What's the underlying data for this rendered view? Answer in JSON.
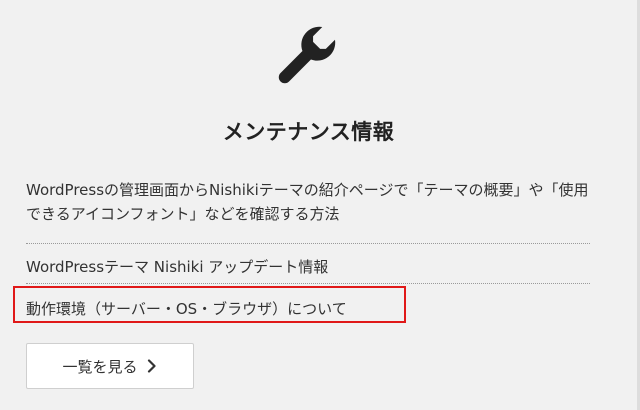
{
  "section": {
    "icon": "wrench-icon",
    "title": "メンテナンス情報"
  },
  "posts": [
    {
      "title": "WordPressの管理画面からNishikiテーマの紹介ページで「テーマの概要」や「使用できるアイコンフォント」などを確認する方法"
    },
    {
      "title": "WordPressテーマ Nishiki アップデート情報"
    },
    {
      "title": "動作環境（サーバー・OS・ブラウザ）について",
      "highlighted": true
    }
  ],
  "more_button": {
    "label": "一覧を見る",
    "icon": "chevron-right-icon"
  },
  "colors": {
    "background": "#f1f1f1",
    "text": "#333333",
    "highlight_border": "#e01818",
    "button_background": "#ffffff"
  }
}
